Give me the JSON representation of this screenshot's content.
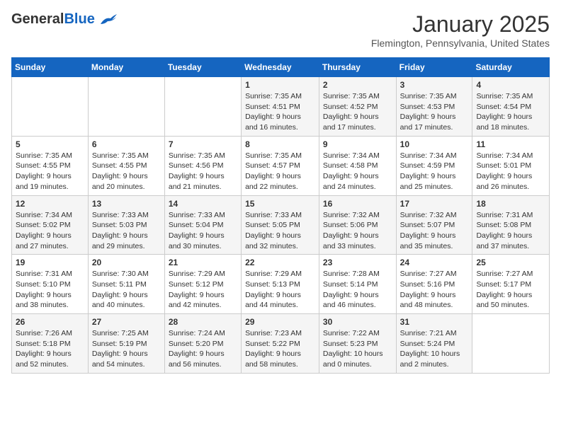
{
  "logo": {
    "general": "General",
    "blue": "Blue"
  },
  "header": {
    "month": "January 2025",
    "location": "Flemington, Pennsylvania, United States"
  },
  "weekdays": [
    "Sunday",
    "Monday",
    "Tuesday",
    "Wednesday",
    "Thursday",
    "Friday",
    "Saturday"
  ],
  "weeks": [
    [
      {
        "day": "",
        "sunrise": "",
        "sunset": "",
        "daylight": ""
      },
      {
        "day": "",
        "sunrise": "",
        "sunset": "",
        "daylight": ""
      },
      {
        "day": "",
        "sunrise": "",
        "sunset": "",
        "daylight": ""
      },
      {
        "day": "1",
        "sunrise": "Sunrise: 7:35 AM",
        "sunset": "Sunset: 4:51 PM",
        "daylight": "Daylight: 9 hours and 16 minutes."
      },
      {
        "day": "2",
        "sunrise": "Sunrise: 7:35 AM",
        "sunset": "Sunset: 4:52 PM",
        "daylight": "Daylight: 9 hours and 17 minutes."
      },
      {
        "day": "3",
        "sunrise": "Sunrise: 7:35 AM",
        "sunset": "Sunset: 4:53 PM",
        "daylight": "Daylight: 9 hours and 17 minutes."
      },
      {
        "day": "4",
        "sunrise": "Sunrise: 7:35 AM",
        "sunset": "Sunset: 4:54 PM",
        "daylight": "Daylight: 9 hours and 18 minutes."
      }
    ],
    [
      {
        "day": "5",
        "sunrise": "Sunrise: 7:35 AM",
        "sunset": "Sunset: 4:55 PM",
        "daylight": "Daylight: 9 hours and 19 minutes."
      },
      {
        "day": "6",
        "sunrise": "Sunrise: 7:35 AM",
        "sunset": "Sunset: 4:55 PM",
        "daylight": "Daylight: 9 hours and 20 minutes."
      },
      {
        "day": "7",
        "sunrise": "Sunrise: 7:35 AM",
        "sunset": "Sunset: 4:56 PM",
        "daylight": "Daylight: 9 hours and 21 minutes."
      },
      {
        "day": "8",
        "sunrise": "Sunrise: 7:35 AM",
        "sunset": "Sunset: 4:57 PM",
        "daylight": "Daylight: 9 hours and 22 minutes."
      },
      {
        "day": "9",
        "sunrise": "Sunrise: 7:34 AM",
        "sunset": "Sunset: 4:58 PM",
        "daylight": "Daylight: 9 hours and 24 minutes."
      },
      {
        "day": "10",
        "sunrise": "Sunrise: 7:34 AM",
        "sunset": "Sunset: 4:59 PM",
        "daylight": "Daylight: 9 hours and 25 minutes."
      },
      {
        "day": "11",
        "sunrise": "Sunrise: 7:34 AM",
        "sunset": "Sunset: 5:01 PM",
        "daylight": "Daylight: 9 hours and 26 minutes."
      }
    ],
    [
      {
        "day": "12",
        "sunrise": "Sunrise: 7:34 AM",
        "sunset": "Sunset: 5:02 PM",
        "daylight": "Daylight: 9 hours and 27 minutes."
      },
      {
        "day": "13",
        "sunrise": "Sunrise: 7:33 AM",
        "sunset": "Sunset: 5:03 PM",
        "daylight": "Daylight: 9 hours and 29 minutes."
      },
      {
        "day": "14",
        "sunrise": "Sunrise: 7:33 AM",
        "sunset": "Sunset: 5:04 PM",
        "daylight": "Daylight: 9 hours and 30 minutes."
      },
      {
        "day": "15",
        "sunrise": "Sunrise: 7:33 AM",
        "sunset": "Sunset: 5:05 PM",
        "daylight": "Daylight: 9 hours and 32 minutes."
      },
      {
        "day": "16",
        "sunrise": "Sunrise: 7:32 AM",
        "sunset": "Sunset: 5:06 PM",
        "daylight": "Daylight: 9 hours and 33 minutes."
      },
      {
        "day": "17",
        "sunrise": "Sunrise: 7:32 AM",
        "sunset": "Sunset: 5:07 PM",
        "daylight": "Daylight: 9 hours and 35 minutes."
      },
      {
        "day": "18",
        "sunrise": "Sunrise: 7:31 AM",
        "sunset": "Sunset: 5:08 PM",
        "daylight": "Daylight: 9 hours and 37 minutes."
      }
    ],
    [
      {
        "day": "19",
        "sunrise": "Sunrise: 7:31 AM",
        "sunset": "Sunset: 5:10 PM",
        "daylight": "Daylight: 9 hours and 38 minutes."
      },
      {
        "day": "20",
        "sunrise": "Sunrise: 7:30 AM",
        "sunset": "Sunset: 5:11 PM",
        "daylight": "Daylight: 9 hours and 40 minutes."
      },
      {
        "day": "21",
        "sunrise": "Sunrise: 7:29 AM",
        "sunset": "Sunset: 5:12 PM",
        "daylight": "Daylight: 9 hours and 42 minutes."
      },
      {
        "day": "22",
        "sunrise": "Sunrise: 7:29 AM",
        "sunset": "Sunset: 5:13 PM",
        "daylight": "Daylight: 9 hours and 44 minutes."
      },
      {
        "day": "23",
        "sunrise": "Sunrise: 7:28 AM",
        "sunset": "Sunset: 5:14 PM",
        "daylight": "Daylight: 9 hours and 46 minutes."
      },
      {
        "day": "24",
        "sunrise": "Sunrise: 7:27 AM",
        "sunset": "Sunset: 5:16 PM",
        "daylight": "Daylight: 9 hours and 48 minutes."
      },
      {
        "day": "25",
        "sunrise": "Sunrise: 7:27 AM",
        "sunset": "Sunset: 5:17 PM",
        "daylight": "Daylight: 9 hours and 50 minutes."
      }
    ],
    [
      {
        "day": "26",
        "sunrise": "Sunrise: 7:26 AM",
        "sunset": "Sunset: 5:18 PM",
        "daylight": "Daylight: 9 hours and 52 minutes."
      },
      {
        "day": "27",
        "sunrise": "Sunrise: 7:25 AM",
        "sunset": "Sunset: 5:19 PM",
        "daylight": "Daylight: 9 hours and 54 minutes."
      },
      {
        "day": "28",
        "sunrise": "Sunrise: 7:24 AM",
        "sunset": "Sunset: 5:20 PM",
        "daylight": "Daylight: 9 hours and 56 minutes."
      },
      {
        "day": "29",
        "sunrise": "Sunrise: 7:23 AM",
        "sunset": "Sunset: 5:22 PM",
        "daylight": "Daylight: 9 hours and 58 minutes."
      },
      {
        "day": "30",
        "sunrise": "Sunrise: 7:22 AM",
        "sunset": "Sunset: 5:23 PM",
        "daylight": "Daylight: 10 hours and 0 minutes."
      },
      {
        "day": "31",
        "sunrise": "Sunrise: 7:21 AM",
        "sunset": "Sunset: 5:24 PM",
        "daylight": "Daylight: 10 hours and 2 minutes."
      },
      {
        "day": "",
        "sunrise": "",
        "sunset": "",
        "daylight": ""
      }
    ]
  ]
}
